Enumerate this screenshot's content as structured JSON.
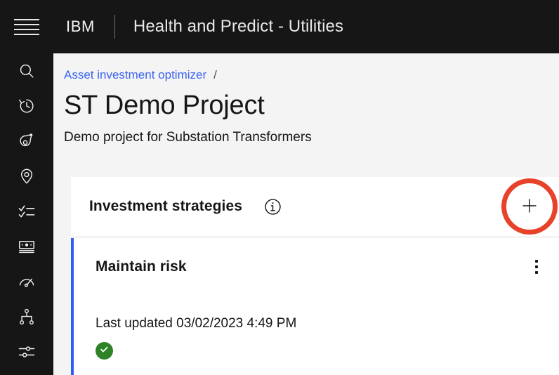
{
  "header": {
    "menu_label": "Open menu",
    "brand": "IBM",
    "app_name": "Health and Predict - Utilities"
  },
  "sidebar": {
    "items": [
      {
        "icon": "search-icon",
        "label": "Search"
      },
      {
        "icon": "history-icon",
        "label": "History"
      },
      {
        "icon": "asset-tag-icon",
        "label": "Assets"
      },
      {
        "icon": "location-pin-icon",
        "label": "Locations"
      },
      {
        "icon": "checklist-icon",
        "label": "Tasks"
      },
      {
        "icon": "money-icon",
        "label": "Investments"
      },
      {
        "icon": "gauge-icon",
        "label": "Performance"
      },
      {
        "icon": "hierarchy-icon",
        "label": "Hierarchy"
      },
      {
        "icon": "sliders-icon",
        "label": "Settings"
      }
    ]
  },
  "breadcrumb": {
    "link": "Asset investment optimizer",
    "separator": "/"
  },
  "page": {
    "title": "ST Demo Project",
    "subtitle": "Demo project for Substation Transformers"
  },
  "panel": {
    "title": "Investment strategies",
    "info_label": "More information",
    "add_label": "+",
    "highlight_color": "#e8422a"
  },
  "strategy_card": {
    "title": "Maintain risk",
    "updated": "Last updated 03/02/2023 4:49 PM",
    "status": "complete",
    "status_color": "#2e8326",
    "accent_color": "#2f5ff0",
    "overflow_label": "Options"
  }
}
